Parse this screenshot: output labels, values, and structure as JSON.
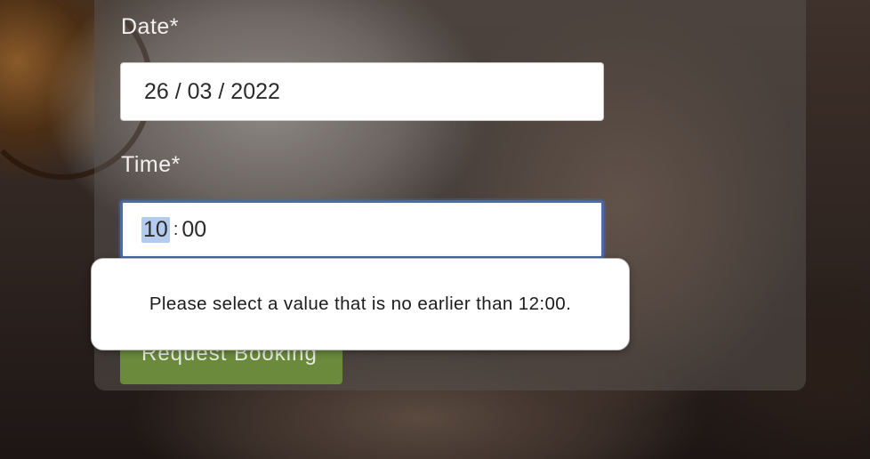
{
  "form": {
    "date": {
      "label": "Date*",
      "value": "26 / 03 / 2022"
    },
    "time": {
      "label": "Time*",
      "hour": "10",
      "separator": ":",
      "minute": "00"
    },
    "submit_label": "Request Booking"
  },
  "validation_tooltip": {
    "message": "Please select a value that is no earlier than 12:00."
  }
}
